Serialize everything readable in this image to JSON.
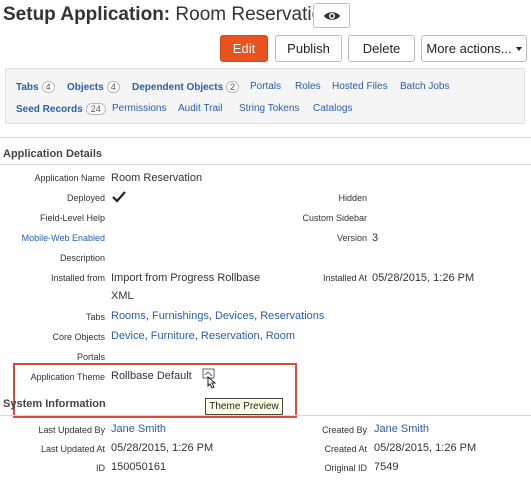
{
  "header": {
    "title_prefix": "Setup Application:",
    "title_name": "Room Reservation"
  },
  "toolbar": {
    "edit": "Edit",
    "publish": "Publish",
    "delete": "Delete",
    "more": "More actions..."
  },
  "tabs": [
    {
      "label": "Tabs",
      "count": "4",
      "bold": true
    },
    {
      "label": "Objects",
      "count": "4",
      "bold": true
    },
    {
      "label": "Dependent Objects",
      "count": "2",
      "bold": true
    },
    {
      "label": "Portals"
    },
    {
      "label": "Roles"
    },
    {
      "label": "Hosted Files"
    },
    {
      "label": "Batch Jobs"
    },
    {
      "label": "Seed Records",
      "count": "24",
      "bold": true
    },
    {
      "label": "Permissions"
    },
    {
      "label": "Audit Trail"
    },
    {
      "label": "String Tokens"
    },
    {
      "label": "Catalogs"
    }
  ],
  "details": {
    "section_title": "Application Details",
    "app_name_label": "Application Name",
    "app_name": "Room Reservation",
    "deployed_label": "Deployed",
    "hidden_label": "Hidden",
    "flh_label": "Field-Level Help",
    "custom_sidebar_label": "Custom Sidebar",
    "mobile_label": "Mobile-Web Enabled",
    "version_label": "Version",
    "version": "3",
    "description_label": "Description",
    "installed_from_label": "Installed from",
    "installed_from_1": "Import from Progress Rollbase",
    "installed_from_2": "XML",
    "installed_at_label": "Installed At",
    "installed_at": "05/28/2015, 1:26 PM",
    "tabs_label": "Tabs",
    "tabs_links": [
      "Rooms",
      "Furnishings",
      "Devices",
      "Reservations"
    ],
    "core_label": "Core Objects",
    "core_links": [
      "Device",
      "Furniture",
      "Reservation",
      "Room"
    ],
    "portals_label": "Portals",
    "theme_label": "Application Theme",
    "theme_value": "Rollbase Default",
    "tooltip": "Theme Preview"
  },
  "system": {
    "section_title": "System Information",
    "updated_by_label": "Last Updated By",
    "updated_by": "Jane Smith",
    "created_by_label": "Created By",
    "created_by": "Jane Smith",
    "updated_at_label": "Last Updated At",
    "updated_at": "05/28/2015, 1:26 PM",
    "created_at_label": "Created At",
    "created_at": "05/28/2015, 1:26 PM",
    "id_label": "ID",
    "id": "150050161",
    "original_id_label": "Original ID",
    "original_id": "7549"
  }
}
